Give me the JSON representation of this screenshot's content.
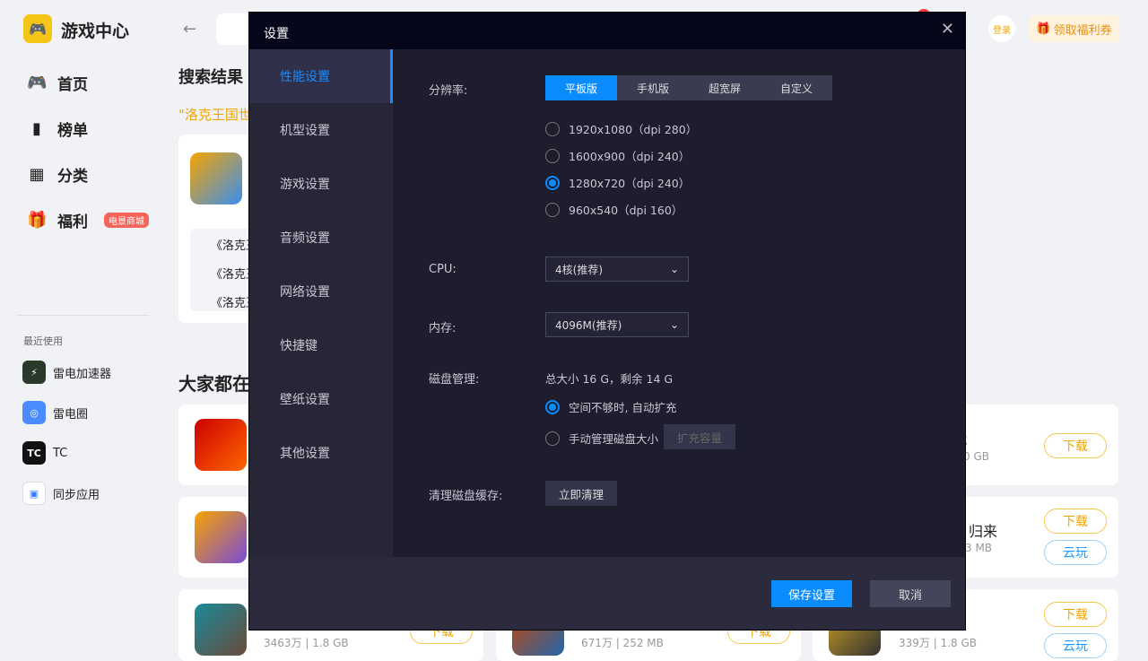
{
  "app": {
    "title": "游戏中心",
    "login": "登录",
    "coupon": "领取福利券"
  },
  "nav": [
    {
      "label": "首页",
      "icon": "gamepad-icon"
    },
    {
      "label": "榜单",
      "icon": "chart-icon"
    },
    {
      "label": "分类",
      "icon": "category-icon"
    },
    {
      "label": "福利",
      "icon": "gift-icon",
      "badge": "电景商城"
    }
  ],
  "recent": {
    "title": "最近使用",
    "items": [
      "雷电加速器",
      "雷电圈",
      "TC",
      "同步应用"
    ]
  },
  "main": {
    "search_title": "搜索结果",
    "query": "\"洛克王国世",
    "results": [
      "《洛克王",
      "《洛克王",
      "《洛克王"
    ],
    "section": "大家都在",
    "games": [
      {
        "name_tail": "戟",
        "meta_tail": "0 GB",
        "download": "下载"
      },
      {
        "name_tail": "归来",
        "meta_tail": "3 MB",
        "download": "下载",
        "cloud": "云玩"
      },
      {
        "meta": "3463万 | 1.8 GB",
        "download": "下载"
      },
      {
        "meta": "671万 | 252 MB",
        "download": "下载"
      },
      {
        "meta": "339万 | 1.8 GB",
        "download": "下载",
        "cloud": "云玩"
      }
    ]
  },
  "settings": {
    "title": "设置",
    "tabs": [
      "性能设置",
      "机型设置",
      "游戏设置",
      "音频设置",
      "网络设置",
      "快捷键",
      "壁纸设置",
      "其他设置"
    ],
    "resolution_label": "分辨率:",
    "modes": [
      "平板版",
      "手机版",
      "超宽屏",
      "自定义"
    ],
    "resolutions": [
      "1920x1080（dpi 280）",
      "1600x900（dpi 240）",
      "1280x720（dpi 240）",
      "960x540（dpi 160）"
    ],
    "cpu_label": "CPU:",
    "cpu_value": "4核(推荐)",
    "mem_label": "内存:",
    "mem_value": "4096M(推荐)",
    "disk_label": "磁盘管理:",
    "disk_info": "总大小 16 G，剩余 14 G",
    "disk_auto": "空间不够时, 自动扩充",
    "disk_manual": "手动管理磁盘大小",
    "expand": "扩充容量",
    "cache_label": "清理磁盘缓存:",
    "clean": "立即清理",
    "save": "保存设置",
    "cancel": "取消"
  }
}
